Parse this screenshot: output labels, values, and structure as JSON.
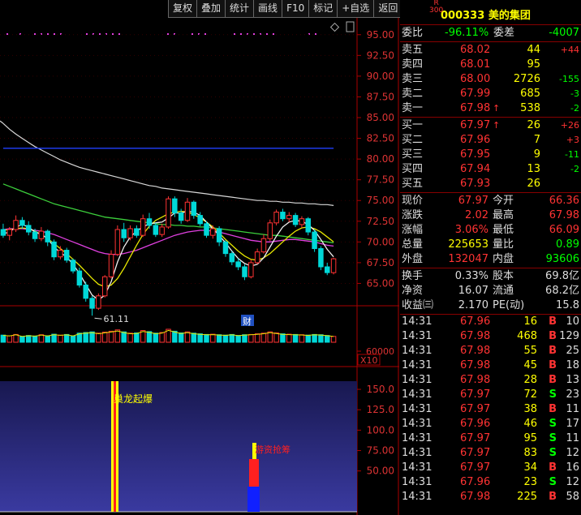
{
  "toolbar": {
    "buttons": [
      "复权",
      "叠加",
      "统计",
      "画线",
      "F10",
      "标记",
      "+自选",
      "返回"
    ]
  },
  "chart": {
    "price_ticks": [
      "95.00",
      "92.50",
      "90.00",
      "87.50",
      "85.00",
      "82.50",
      "80.00",
      "77.50",
      "75.00",
      "72.50",
      "70.00",
      "67.50",
      "65.00"
    ],
    "volume_tick": "60000",
    "volume_unit": "X10",
    "indicator_ticks": [
      "150.0",
      "125.0",
      "100.0",
      "75.00",
      "50.00"
    ],
    "low_label": "61.11",
    "cai_label": "财",
    "signal_1": "巢龙起爆",
    "signal_2": "游资抢筹"
  },
  "stock": {
    "r_badge": "R\n300",
    "code": "000333",
    "name": "美的集团"
  },
  "weibi": {
    "label": "委比",
    "value": "-96.11%",
    "label2": "委差",
    "value2": "-4007"
  },
  "sells": [
    {
      "label": "卖五",
      "price": "68.02",
      "vol": "44",
      "chg": "+44"
    },
    {
      "label": "卖四",
      "price": "68.01",
      "vol": "95",
      "chg": ""
    },
    {
      "label": "卖三",
      "price": "68.00",
      "vol": "2726",
      "chg": "-155"
    },
    {
      "label": "卖二",
      "price": "67.99",
      "vol": "685",
      "chg": "-3"
    },
    {
      "label": "卖一",
      "price": "67.98",
      "vol": "538",
      "chg": "-2",
      "arrow": "↑"
    }
  ],
  "buys": [
    {
      "label": "买一",
      "price": "67.97",
      "vol": "26",
      "chg": "+26",
      "arrow": "↑"
    },
    {
      "label": "买二",
      "price": "67.96",
      "vol": "7",
      "chg": "+3"
    },
    {
      "label": "买三",
      "price": "67.95",
      "vol": "9",
      "chg": "-11"
    },
    {
      "label": "买四",
      "price": "67.94",
      "vol": "13",
      "chg": "-2"
    },
    {
      "label": "买五",
      "price": "67.93",
      "vol": "26",
      "chg": ""
    }
  ],
  "quote": [
    {
      "l1": "现价",
      "v1": "67.97",
      "c1": "red",
      "l2": "今开",
      "v2": "66.36",
      "c2": "red"
    },
    {
      "l1": "涨跌",
      "v1": "2.02",
      "c1": "red",
      "l2": "最高",
      "v2": "67.98",
      "c2": "red"
    },
    {
      "l1": "涨幅",
      "v1": "3.06%",
      "c1": "red",
      "l2": "最低",
      "v2": "66.09",
      "c2": "red"
    },
    {
      "l1": "总量",
      "v1": "225653",
      "c1": "yellow",
      "l2": "量比",
      "v2": "0.89",
      "c2": "green"
    },
    {
      "l1": "外盘",
      "v1": "132047",
      "c1": "red",
      "l2": "内盘",
      "v2": "93606",
      "c2": "green"
    }
  ],
  "fund": [
    {
      "l1": "换手",
      "v1": "0.33%",
      "l2": "股本",
      "v2": "69.8亿"
    },
    {
      "l1": "净资",
      "v1": "16.07",
      "l2": "流通",
      "v2": "68.2亿"
    },
    {
      "l1": "收益㈢",
      "v1": "2.170",
      "l2": "PE(动)",
      "v2": "15.8"
    }
  ],
  "trades": [
    {
      "t": "14:31",
      "p": "67.96",
      "v": "16",
      "s": "B",
      "n": "10"
    },
    {
      "t": "14:31",
      "p": "67.98",
      "v": "468",
      "s": "B",
      "n": "129"
    },
    {
      "t": "14:31",
      "p": "67.98",
      "v": "55",
      "s": "B",
      "n": "25"
    },
    {
      "t": "14:31",
      "p": "67.98",
      "v": "45",
      "s": "B",
      "n": "18"
    },
    {
      "t": "14:31",
      "p": "67.98",
      "v": "28",
      "s": "B",
      "n": "13"
    },
    {
      "t": "14:31",
      "p": "67.97",
      "v": "72",
      "s": "S",
      "n": "23"
    },
    {
      "t": "14:31",
      "p": "67.97",
      "v": "38",
      "s": "B",
      "n": "11"
    },
    {
      "t": "14:31",
      "p": "67.96",
      "v": "46",
      "s": "S",
      "n": "17"
    },
    {
      "t": "14:31",
      "p": "67.97",
      "v": "95",
      "s": "S",
      "n": "11"
    },
    {
      "t": "14:31",
      "p": "67.97",
      "v": "83",
      "s": "S",
      "n": "12"
    },
    {
      "t": "14:31",
      "p": "67.97",
      "v": "34",
      "s": "B",
      "n": "16"
    },
    {
      "t": "14:31",
      "p": "67.96",
      "v": "23",
      "s": "S",
      "n": "12"
    },
    {
      "t": "14:31",
      "p": "67.98",
      "v": "225",
      "s": "B",
      "n": "58"
    }
  ],
  "chart_data": {
    "type": "candlestick",
    "price_ylim": [
      62.5,
      96.25
    ],
    "price_ticks": [
      95.0,
      92.5,
      90.0,
      87.5,
      85.0,
      82.5,
      80.0,
      77.5,
      75.0,
      72.5,
      70.0,
      67.5,
      65.0
    ],
    "candles": [
      [
        71.5,
        70.8,
        72.2,
        70.5
      ],
      [
        70.8,
        71.5,
        71.8,
        70.2
      ],
      [
        71.5,
        72.6,
        73.2,
        71.2
      ],
      [
        72.6,
        72.0,
        73.0,
        71.6
      ],
      [
        72.0,
        71.2,
        72.5,
        70.8
      ],
      [
        71.2,
        70.4,
        71.6,
        70.0
      ],
      [
        70.4,
        71.3,
        71.8,
        70.1
      ],
      [
        71.3,
        70.0,
        71.5,
        69.5
      ],
      [
        70.0,
        68.2,
        70.3,
        67.8
      ],
      [
        68.2,
        69.0,
        69.5,
        67.9
      ],
      [
        69.0,
        67.8,
        69.3,
        67.5
      ],
      [
        67.8,
        66.5,
        68.0,
        66.2
      ],
      [
        66.5,
        64.8,
        66.9,
        64.5
      ],
      [
        64.8,
        63.2,
        65.2,
        62.8
      ],
      [
        63.2,
        62.0,
        63.5,
        61.11
      ],
      [
        62.0,
        63.5,
        63.8,
        61.8
      ],
      [
        63.5,
        65.8,
        66.0,
        63.3
      ],
      [
        65.8,
        68.5,
        69.0,
        65.6
      ],
      [
        68.5,
        71.5,
        72.0,
        68.3
      ],
      [
        71.5,
        70.5,
        72.3,
        70.0
      ],
      [
        70.5,
        71.6,
        72.0,
        70.2
      ],
      [
        71.6,
        70.8,
        72.0,
        70.5
      ],
      [
        70.8,
        72.8,
        73.3,
        70.6
      ],
      [
        72.8,
        72.0,
        73.5,
        71.6
      ],
      [
        72.0,
        70.9,
        72.3,
        70.6
      ],
      [
        70.9,
        71.8,
        72.2,
        70.6
      ],
      [
        71.8,
        75.2,
        75.5,
        71.6
      ],
      [
        75.2,
        73.5,
        75.5,
        73.0
      ],
      [
        73.5,
        72.6,
        74.0,
        72.2
      ],
      [
        72.6,
        74.8,
        75.3,
        72.4
      ],
      [
        74.8,
        73.2,
        75.0,
        72.8
      ],
      [
        73.2,
        72.2,
        73.6,
        71.9
      ],
      [
        72.2,
        70.8,
        72.5,
        70.5
      ],
      [
        70.8,
        71.6,
        72.0,
        70.4
      ],
      [
        71.6,
        70.0,
        71.9,
        69.5
      ],
      [
        70.0,
        68.6,
        70.2,
        68.2
      ],
      [
        68.6,
        67.6,
        68.9,
        67.2
      ],
      [
        67.6,
        67.0,
        68.0,
        66.6
      ],
      [
        67.0,
        65.8,
        67.3,
        65.4
      ],
      [
        65.8,
        67.5,
        67.9,
        65.6
      ],
      [
        67.5,
        68.8,
        69.2,
        67.3
      ],
      [
        68.8,
        70.4,
        70.9,
        68.6
      ],
      [
        70.4,
        72.3,
        72.7,
        70.1
      ],
      [
        72.3,
        73.6,
        73.9,
        72.0
      ],
      [
        73.6,
        72.8,
        74.0,
        72.5
      ],
      [
        72.8,
        73.2,
        73.6,
        72.4
      ],
      [
        73.2,
        72.1,
        73.5,
        71.8
      ],
      [
        72.1,
        72.8,
        73.1,
        71.7
      ],
      [
        72.8,
        71.2,
        73.0,
        70.8
      ],
      [
        71.2,
        69.2,
        71.5,
        68.8
      ],
      [
        69.2,
        67.0,
        69.5,
        66.6
      ],
      [
        67.0,
        66.3,
        67.5,
        66.0
      ],
      [
        66.3,
        67.97,
        68.1,
        66.09
      ]
    ],
    "ma_lines": [
      {
        "name": "white",
        "color": "#d8d8d8",
        "values": [
          84.3,
          83.6,
          83.0,
          82.5,
          82.0,
          81.5,
          81.1,
          80.7,
          80.3,
          79.9,
          79.6,
          79.3,
          79.0,
          78.8,
          78.6,
          78.4,
          78.2,
          78.0,
          77.8,
          77.6,
          77.4,
          77.2,
          77.0,
          76.8,
          76.7,
          76.5,
          76.4,
          76.3,
          76.2,
          76.1,
          76.0,
          75.9,
          75.8,
          75.7,
          75.6,
          75.5,
          75.4,
          75.3,
          75.2,
          75.1,
          75.0,
          75.0,
          74.9,
          74.9,
          74.8,
          74.8,
          74.7,
          74.7,
          74.6,
          74.6,
          74.5,
          74.5,
          74.4
        ]
      },
      {
        "name": "blue",
        "color": "#2040ff",
        "values": [
          81.3,
          81.3,
          81.3,
          81.3,
          81.3,
          81.3,
          81.3,
          81.3,
          81.3,
          81.3,
          81.3,
          81.3,
          81.3,
          81.3,
          81.3,
          81.3,
          81.3,
          81.3,
          81.3,
          81.3,
          81.3,
          81.3,
          81.3,
          81.3,
          81.3,
          81.3,
          81.3,
          81.3,
          81.3,
          81.3,
          81.3,
          81.3,
          81.3,
          81.3,
          81.3,
          81.3,
          81.3,
          81.3,
          81.3,
          81.3,
          81.3,
          81.3,
          81.3,
          81.3,
          81.3,
          81.3,
          81.3,
          81.3,
          81.3,
          81.3,
          81.3,
          81.3,
          81.3
        ]
      },
      {
        "name": "green",
        "color": "#3ccf3c",
        "values": [
          77.0,
          76.7,
          76.4,
          76.1,
          75.8,
          75.5,
          75.2,
          74.9,
          74.6,
          74.4,
          74.2,
          74.0,
          73.8,
          73.6,
          73.4,
          73.2,
          73.0,
          72.9,
          72.8,
          72.7,
          72.6,
          72.5,
          72.4,
          72.3,
          72.2,
          72.1,
          72.1,
          72.0,
          72.0,
          71.9,
          71.9,
          71.8,
          71.8,
          71.7,
          71.6,
          71.5,
          71.4,
          71.3,
          71.2,
          71.1,
          71.0,
          70.9,
          70.8,
          70.8,
          70.7,
          70.6,
          70.5,
          70.4,
          70.3,
          70.2,
          70.1,
          70.0,
          69.9
        ]
      },
      {
        "name": "magenta",
        "color": "#e040e0",
        "values": [
          71.5,
          71.6,
          71.6,
          71.6,
          71.5,
          71.4,
          71.3,
          71.1,
          70.9,
          70.6,
          70.3,
          70.0,
          69.7,
          69.4,
          69.1,
          68.8,
          68.6,
          68.5,
          68.5,
          68.6,
          68.8,
          69.0,
          69.3,
          69.6,
          69.9,
          70.2,
          70.5,
          70.8,
          71.0,
          71.2,
          71.3,
          71.4,
          71.4,
          71.3,
          71.2,
          71.0,
          70.8,
          70.6,
          70.4,
          70.2,
          70.1,
          70.0,
          70.0,
          70.1,
          70.2,
          70.3,
          70.3,
          70.2,
          70.1,
          70.0,
          69.8,
          69.6,
          69.5
        ]
      },
      {
        "name": "yellow",
        "color": "#e6e600",
        "values": [
          71.4,
          71.5,
          71.6,
          71.7,
          71.6,
          71.3,
          70.9,
          70.4,
          69.8,
          69.2,
          68.6,
          67.9,
          67.2,
          66.4,
          65.6,
          64.9,
          64.6,
          64.8,
          65.6,
          66.8,
          68.2,
          69.6,
          70.9,
          71.9,
          72.6,
          73.0,
          73.4,
          73.6,
          73.7,
          73.6,
          73.3,
          72.9,
          72.4,
          71.8,
          71.1,
          70.3,
          69.6,
          68.9,
          68.3,
          67.9,
          67.8,
          68.1,
          68.6,
          69.3,
          70.0,
          70.7,
          71.3,
          71.7,
          71.8,
          71.6,
          71.2,
          70.6,
          70.0
        ]
      },
      {
        "name": "cyan",
        "color": "#f0f0f0",
        "values": [
          71.0,
          71.2,
          71.8,
          72.1,
          71.8,
          71.2,
          70.9,
          70.4,
          69.4,
          68.7,
          68.2,
          67.3,
          66.2,
          64.9,
          63.6,
          63.0,
          63.6,
          65.2,
          67.6,
          69.4,
          70.6,
          71.3,
          71.8,
          72.2,
          72.3,
          72.4,
          72.9,
          73.5,
          73.5,
          73.7,
          73.6,
          73.2,
          72.4,
          71.6,
          70.8,
          69.9,
          68.9,
          68.0,
          67.4,
          67.1,
          67.3,
          68.1,
          69.4,
          70.7,
          71.8,
          72.4,
          72.6,
          72.5,
          72.1,
          71.4,
          70.3,
          69.1,
          68.2
        ]
      }
    ],
    "volumes": [
      0.55,
      0.5,
      0.6,
      0.45,
      0.52,
      0.48,
      0.58,
      0.5,
      0.62,
      0.55,
      0.6,
      0.5,
      0.7,
      0.75,
      0.8,
      0.7,
      0.78,
      0.85,
      0.95,
      0.8,
      0.7,
      0.72,
      0.9,
      0.82,
      0.7,
      0.75,
      1.0,
      0.85,
      0.72,
      0.8,
      0.7,
      0.65,
      0.6,
      0.62,
      0.58,
      0.55,
      0.6,
      0.52,
      0.58,
      0.6,
      0.65,
      0.7,
      0.8,
      0.72,
      0.65,
      0.62,
      0.6,
      0.58,
      0.55,
      0.6,
      0.58,
      0.52,
      0.45
    ],
    "indicator_ylim": [
      0,
      160
    ]
  }
}
